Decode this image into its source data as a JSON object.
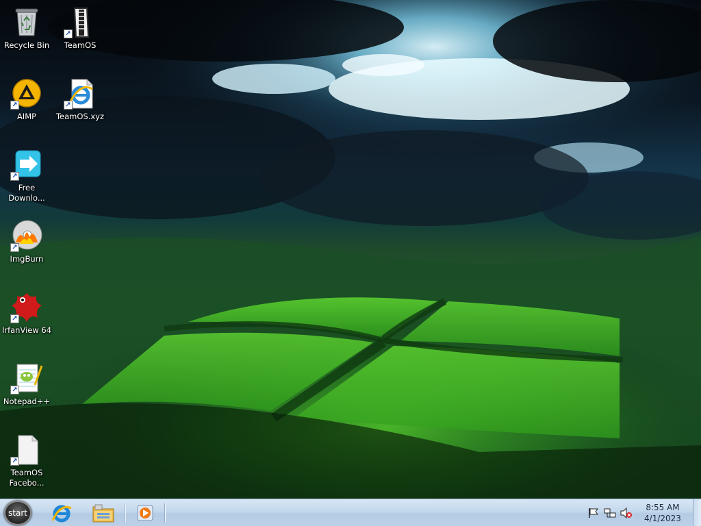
{
  "desktop": {
    "icons": [
      {
        "id": "recycle-bin",
        "label": "Recycle Bin",
        "icon": "recycle-bin-icon"
      },
      {
        "id": "teamos",
        "label": "TeamOS",
        "icon": "zipper-folder-icon"
      },
      {
        "id": "aimp",
        "label": "AIMP",
        "icon": "aimp-icon"
      },
      {
        "id": "teamos-xyz",
        "label": "TeamOS.xyz",
        "icon": "internet-explorer-icon"
      },
      {
        "id": "free-download",
        "label": "Free Downlo...",
        "icon": "free-download-manager-icon"
      },
      {
        "id": "imgburn",
        "label": "ImgBurn",
        "icon": "imgburn-disc-icon"
      },
      {
        "id": "irfanview",
        "label": "IrfanView 64",
        "icon": "irfanview-icon"
      },
      {
        "id": "notepadpp",
        "label": "Notepad++",
        "icon": "notepadpp-icon"
      },
      {
        "id": "teamos-facebook",
        "label": "TeamOS Facebo...",
        "icon": "blank-document-icon"
      }
    ]
  },
  "taskbar": {
    "start_label": "start",
    "pinned": [
      "internet-explorer-icon",
      "file-explorer-icon",
      "media-player-icon"
    ],
    "tray": [
      "action-center-flag-icon",
      "network-icon",
      "volume-muted-icon"
    ],
    "time": "8:55 AM",
    "date": "4/1/2023"
  },
  "colors": {
    "taskbar_bg": "#c4d8ec",
    "grass": "#1d5f22",
    "sky_light": "#8fe0f5"
  }
}
